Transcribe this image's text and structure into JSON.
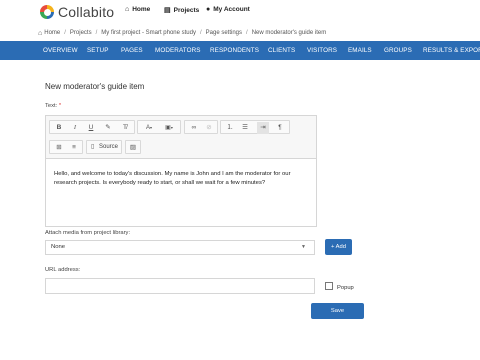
{
  "header": {
    "logo_text": "Collabito",
    "nav": [
      {
        "label": "Home",
        "icon": "home-icon"
      },
      {
        "label": "Projects",
        "icon": "document-icon"
      },
      {
        "label": "My Account",
        "icon": "user-icon"
      }
    ]
  },
  "breadcrumb": [
    "Home",
    "Projects",
    "My first project - Smart phone study",
    "Page settings",
    "New moderator's guide item"
  ],
  "main_nav": [
    "OVERVIEW",
    "SETUP",
    "PAGES",
    "MODERATORS",
    "RESPONDENTS",
    "CLIENTS",
    "VISITORS",
    "EMAILS",
    "GROUPS",
    "RESULTS & EXPORT"
  ],
  "form": {
    "title": "New moderator's guide item",
    "text_label": "Text:",
    "required_mark": "*",
    "source_label": "Source",
    "editor_text": "Hello, and welcome to today's discussion. My name is John and I am the moderator for our research projects. Is everybody ready to start, or shall we wait for a few minutes?",
    "media_label": "Attach media from project library:",
    "media_value": "None",
    "add_label": "+ Add",
    "url_label": "URL address:",
    "url_value": "",
    "popup_label": "Popup",
    "save_label": "Save"
  },
  "colors": {
    "nav_bg": "#2b6cb4",
    "button_bg": "#2b6cb4"
  }
}
